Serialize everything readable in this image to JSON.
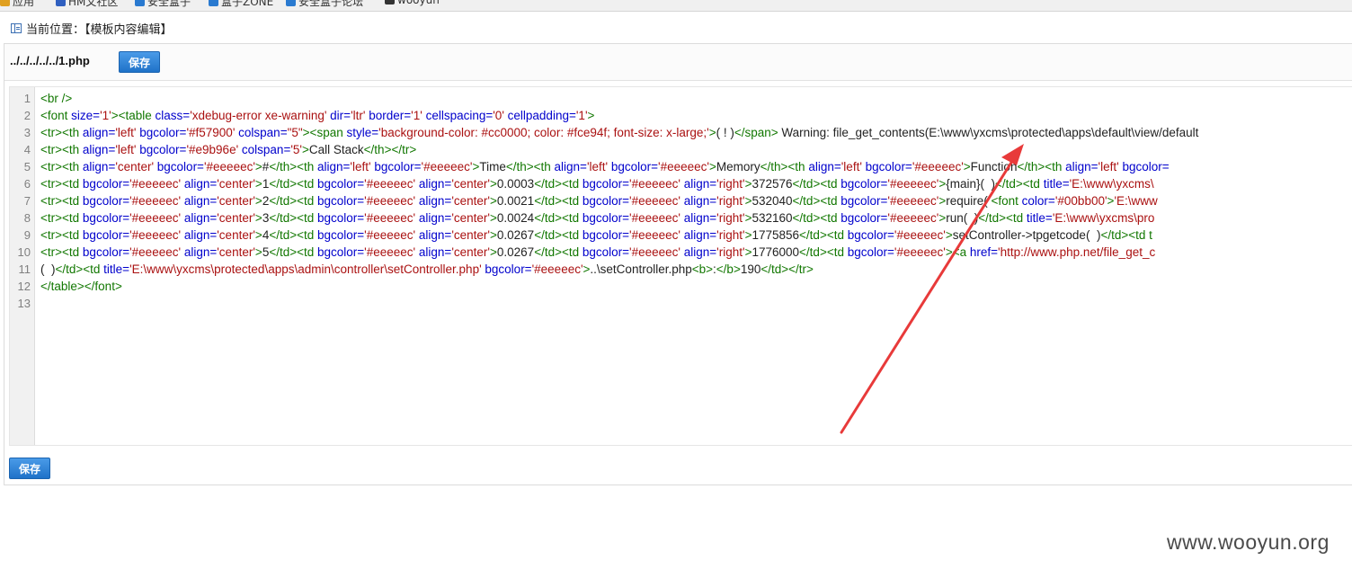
{
  "bookmarks": [
    {
      "label": "应用",
      "color": "#e0a020"
    },
    {
      "label": "HM文社区",
      "color": "#3060c0"
    },
    {
      "label": "安全盒子",
      "color": "#2a7ad0"
    },
    {
      "label": "盒子ZONE",
      "color": "#2a7ad0"
    },
    {
      "label": "安全盒子论坛",
      "color": "#2a7ad0"
    },
    {
      "label": "wooyun",
      "color": "#333333"
    }
  ],
  "breadcrumb": {
    "label": "当前位置：【模板内容编辑】"
  },
  "editor": {
    "file_path": "../../../../../1.php",
    "save_label": "保存",
    "line_numbers": [
      "1",
      "2",
      "3",
      "4",
      "5",
      "6",
      "7",
      "8",
      "9",
      "10",
      "11",
      "12",
      "13"
    ],
    "lines": [
      [
        [
          "tag",
          "<br />"
        ]
      ],
      [
        [
          "tag",
          "<font "
        ],
        [
          "attr",
          "size="
        ],
        [
          "str",
          "'1'"
        ],
        [
          "tag",
          "><table "
        ],
        [
          "attr",
          "class="
        ],
        [
          "str",
          "'xdebug-error xe-warning' "
        ],
        [
          "attr",
          "dir="
        ],
        [
          "str",
          "'ltr' "
        ],
        [
          "attr",
          "border="
        ],
        [
          "str",
          "'1' "
        ],
        [
          "attr",
          "cellspacing="
        ],
        [
          "str",
          "'0' "
        ],
        [
          "attr",
          "cellpadding="
        ],
        [
          "str",
          "'1'"
        ],
        [
          "tag",
          ">"
        ]
      ],
      [
        [
          "tag",
          "<tr><th "
        ],
        [
          "attr",
          "align="
        ],
        [
          "str",
          "'left' "
        ],
        [
          "attr",
          "bgcolor="
        ],
        [
          "str",
          "'#f57900' "
        ],
        [
          "attr",
          "colspan="
        ],
        [
          "str",
          "\"5\""
        ],
        [
          "tag",
          "><span "
        ],
        [
          "attr",
          "style="
        ],
        [
          "str",
          "'background-color: #cc0000; color: #fce94f; font-size: x-large;'"
        ],
        [
          "tag",
          ">"
        ],
        [
          "txt",
          "( ! )"
        ],
        [
          "tag",
          "</span>"
        ],
        [
          "txt",
          " Warning: file_get_contents(E:\\www\\yxcms\\protected\\apps\\default\\view/default"
        ]
      ],
      [
        [
          "tag",
          "<tr><th "
        ],
        [
          "attr",
          "align="
        ],
        [
          "str",
          "'left' "
        ],
        [
          "attr",
          "bgcolor="
        ],
        [
          "str",
          "'#e9b96e' "
        ],
        [
          "attr",
          "colspan="
        ],
        [
          "str",
          "'5'"
        ],
        [
          "tag",
          ">"
        ],
        [
          "txt",
          "Call Stack"
        ],
        [
          "tag",
          "</th></tr>"
        ]
      ],
      [
        [
          "tag",
          "<tr><th "
        ],
        [
          "attr",
          "align="
        ],
        [
          "str",
          "'center' "
        ],
        [
          "attr",
          "bgcolor="
        ],
        [
          "str",
          "'#eeeeec'"
        ],
        [
          "tag",
          ">"
        ],
        [
          "txt",
          "#"
        ],
        [
          "tag",
          "</th><th "
        ],
        [
          "attr",
          "align="
        ],
        [
          "str",
          "'left' "
        ],
        [
          "attr",
          "bgcolor="
        ],
        [
          "str",
          "'#eeeeec'"
        ],
        [
          "tag",
          ">"
        ],
        [
          "txt",
          "Time"
        ],
        [
          "tag",
          "</th><th "
        ],
        [
          "attr",
          "align="
        ],
        [
          "str",
          "'left' "
        ],
        [
          "attr",
          "bgcolor="
        ],
        [
          "str",
          "'#eeeeec'"
        ],
        [
          "tag",
          ">"
        ],
        [
          "txt",
          "Memory"
        ],
        [
          "tag",
          "</th><th "
        ],
        [
          "attr",
          "align="
        ],
        [
          "str",
          "'left' "
        ],
        [
          "attr",
          "bgcolor="
        ],
        [
          "str",
          "'#eeeeec'"
        ],
        [
          "tag",
          ">"
        ],
        [
          "txt",
          "Function"
        ],
        [
          "tag",
          "</th><th "
        ],
        [
          "attr",
          "align="
        ],
        [
          "str",
          "'left' "
        ],
        [
          "attr",
          "bgcolor="
        ]
      ],
      [
        [
          "tag",
          "<tr><td "
        ],
        [
          "attr",
          "bgcolor="
        ],
        [
          "str",
          "'#eeeeec' "
        ],
        [
          "attr",
          "align="
        ],
        [
          "str",
          "'center'"
        ],
        [
          "tag",
          ">"
        ],
        [
          "txt",
          "1"
        ],
        [
          "tag",
          "</td><td "
        ],
        [
          "attr",
          "bgcolor="
        ],
        [
          "str",
          "'#eeeeec' "
        ],
        [
          "attr",
          "align="
        ],
        [
          "str",
          "'center'"
        ],
        [
          "tag",
          ">"
        ],
        [
          "txt",
          "0.0003"
        ],
        [
          "tag",
          "</td><td "
        ],
        [
          "attr",
          "bgcolor="
        ],
        [
          "str",
          "'#eeeeec' "
        ],
        [
          "attr",
          "align="
        ],
        [
          "str",
          "'right'"
        ],
        [
          "tag",
          ">"
        ],
        [
          "txt",
          "372576"
        ],
        [
          "tag",
          "</td><td "
        ],
        [
          "attr",
          "bgcolor="
        ],
        [
          "str",
          "'#eeeeec'"
        ],
        [
          "tag",
          ">"
        ],
        [
          "txt",
          "{main}(  )"
        ],
        [
          "tag",
          "</td><td "
        ],
        [
          "attr",
          "title="
        ],
        [
          "str",
          "'E:\\www\\yxcms\\"
        ]
      ],
      [
        [
          "tag",
          "<tr><td "
        ],
        [
          "attr",
          "bgcolor="
        ],
        [
          "str",
          "'#eeeeec' "
        ],
        [
          "attr",
          "align="
        ],
        [
          "str",
          "'center'"
        ],
        [
          "tag",
          ">"
        ],
        [
          "txt",
          "2"
        ],
        [
          "tag",
          "</td><td "
        ],
        [
          "attr",
          "bgcolor="
        ],
        [
          "str",
          "'#eeeeec' "
        ],
        [
          "attr",
          "align="
        ],
        [
          "str",
          "'center'"
        ],
        [
          "tag",
          ">"
        ],
        [
          "txt",
          "0.0021"
        ],
        [
          "tag",
          "</td><td "
        ],
        [
          "attr",
          "bgcolor="
        ],
        [
          "str",
          "'#eeeeec' "
        ],
        [
          "attr",
          "align="
        ],
        [
          "str",
          "'right'"
        ],
        [
          "tag",
          ">"
        ],
        [
          "txt",
          "532040"
        ],
        [
          "tag",
          "</td><td "
        ],
        [
          "attr",
          "bgcolor="
        ],
        [
          "str",
          "'#eeeeec'"
        ],
        [
          "tag",
          ">"
        ],
        [
          "txt",
          "require( "
        ],
        [
          "tag",
          "<font "
        ],
        [
          "attr",
          "color="
        ],
        [
          "str",
          "'#00bb00'"
        ],
        [
          "tag",
          ">"
        ],
        [
          "str",
          "'E:\\www"
        ]
      ],
      [
        [
          "tag",
          "<tr><td "
        ],
        [
          "attr",
          "bgcolor="
        ],
        [
          "str",
          "'#eeeeec' "
        ],
        [
          "attr",
          "align="
        ],
        [
          "str",
          "'center'"
        ],
        [
          "tag",
          ">"
        ],
        [
          "txt",
          "3"
        ],
        [
          "tag",
          "</td><td "
        ],
        [
          "attr",
          "bgcolor="
        ],
        [
          "str",
          "'#eeeeec' "
        ],
        [
          "attr",
          "align="
        ],
        [
          "str",
          "'center'"
        ],
        [
          "tag",
          ">"
        ],
        [
          "txt",
          "0.0024"
        ],
        [
          "tag",
          "</td><td "
        ],
        [
          "attr",
          "bgcolor="
        ],
        [
          "str",
          "'#eeeeec' "
        ],
        [
          "attr",
          "align="
        ],
        [
          "str",
          "'right'"
        ],
        [
          "tag",
          ">"
        ],
        [
          "txt",
          "532160"
        ],
        [
          "tag",
          "</td><td "
        ],
        [
          "attr",
          "bgcolor="
        ],
        [
          "str",
          "'#eeeeec'"
        ],
        [
          "tag",
          ">"
        ],
        [
          "txt",
          "run(  )"
        ],
        [
          "tag",
          "</td><td "
        ],
        [
          "attr",
          "title="
        ],
        [
          "str",
          "'E:\\www\\yxcms\\pro"
        ]
      ],
      [
        [
          "tag",
          "<tr><td "
        ],
        [
          "attr",
          "bgcolor="
        ],
        [
          "str",
          "'#eeeeec' "
        ],
        [
          "attr",
          "align="
        ],
        [
          "str",
          "'center'"
        ],
        [
          "tag",
          ">"
        ],
        [
          "txt",
          "4"
        ],
        [
          "tag",
          "</td><td "
        ],
        [
          "attr",
          "bgcolor="
        ],
        [
          "str",
          "'#eeeeec' "
        ],
        [
          "attr",
          "align="
        ],
        [
          "str",
          "'center'"
        ],
        [
          "tag",
          ">"
        ],
        [
          "txt",
          "0.0267"
        ],
        [
          "tag",
          "</td><td "
        ],
        [
          "attr",
          "bgcolor="
        ],
        [
          "str",
          "'#eeeeec' "
        ],
        [
          "attr",
          "align="
        ],
        [
          "str",
          "'right'"
        ],
        [
          "tag",
          ">"
        ],
        [
          "txt",
          "1775856"
        ],
        [
          "tag",
          "</td><td "
        ],
        [
          "attr",
          "bgcolor="
        ],
        [
          "str",
          "'#eeeeec'"
        ],
        [
          "tag",
          ">"
        ],
        [
          "txt",
          "setController->tpgetcode(  )"
        ],
        [
          "tag",
          "</td><td t"
        ]
      ],
      [
        [
          "tag",
          "<tr><td "
        ],
        [
          "attr",
          "bgcolor="
        ],
        [
          "str",
          "'#eeeeec' "
        ],
        [
          "attr",
          "align="
        ],
        [
          "str",
          "'center'"
        ],
        [
          "tag",
          ">"
        ],
        [
          "txt",
          "5"
        ],
        [
          "tag",
          "</td><td "
        ],
        [
          "attr",
          "bgcolor="
        ],
        [
          "str",
          "'#eeeeec' "
        ],
        [
          "attr",
          "align="
        ],
        [
          "str",
          "'center'"
        ],
        [
          "tag",
          ">"
        ],
        [
          "txt",
          "0.0267"
        ],
        [
          "tag",
          "</td><td "
        ],
        [
          "attr",
          "bgcolor="
        ],
        [
          "str",
          "'#eeeeec' "
        ],
        [
          "attr",
          "align="
        ],
        [
          "str",
          "'right'"
        ],
        [
          "tag",
          ">"
        ],
        [
          "txt",
          "1776000"
        ],
        [
          "tag",
          "</td><td "
        ],
        [
          "attr",
          "bgcolor="
        ],
        [
          "str",
          "'#eeeeec'"
        ],
        [
          "tag",
          "><a "
        ],
        [
          "attr",
          "href="
        ],
        [
          "str",
          "'http://www.php.net/file_get_c"
        ]
      ],
      [
        [
          "txt",
          "(  )"
        ],
        [
          "tag",
          "</td><td "
        ],
        [
          "attr",
          "title="
        ],
        [
          "str",
          "'E:\\www\\yxcms\\protected\\apps\\admin\\controller\\setController.php' "
        ],
        [
          "attr",
          "bgcolor="
        ],
        [
          "str",
          "'#eeeeec'"
        ],
        [
          "tag",
          ">"
        ],
        [
          "txt",
          "..\\setController.php"
        ],
        [
          "tag",
          "<b>"
        ],
        [
          "txt",
          ":"
        ],
        [
          "tag",
          "</b>"
        ],
        [
          "txt",
          "190"
        ],
        [
          "tag",
          "</td></tr>"
        ]
      ],
      [
        [
          "tag",
          "</table></font>"
        ]
      ],
      []
    ]
  },
  "footer": {
    "save_label": "保存"
  },
  "annotation": {
    "color": "#e83a3a"
  },
  "watermark": {
    "text": "www.wooyun.org"
  }
}
